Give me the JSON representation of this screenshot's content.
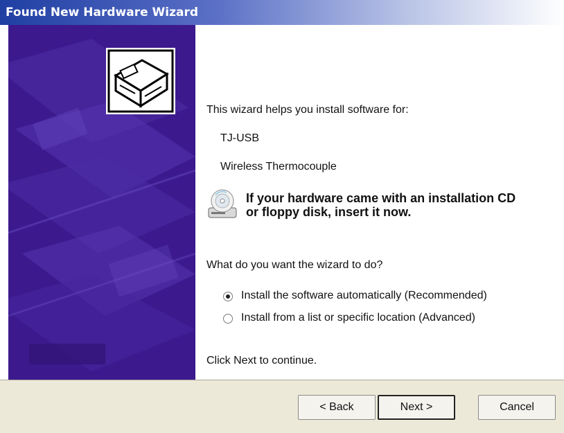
{
  "window": {
    "title": "Found New Hardware Wizard"
  },
  "intro": {
    "text": "This wizard helps you install software for:",
    "device_name": "TJ-USB",
    "device_description": "Wireless Thermocouple"
  },
  "cd_notice": {
    "icon": "cd-drive-icon",
    "line1": "If your hardware came with an installation CD",
    "line2": "or floppy disk, insert it now."
  },
  "question": "What do you want the wizard to do?",
  "options": [
    {
      "label": "Install the software automatically (Recommended)",
      "checked": true
    },
    {
      "label": "Install from a list or specific location (Advanced)",
      "checked": false
    }
  ],
  "continue_text": "Click Next to continue.",
  "buttons": {
    "back": "< Back",
    "next": "Next >",
    "cancel": "Cancel"
  },
  "colors": {
    "title_bar": "#1f3fa3",
    "side_panel": "#3c1a8e",
    "footer": "#ece9d8"
  }
}
